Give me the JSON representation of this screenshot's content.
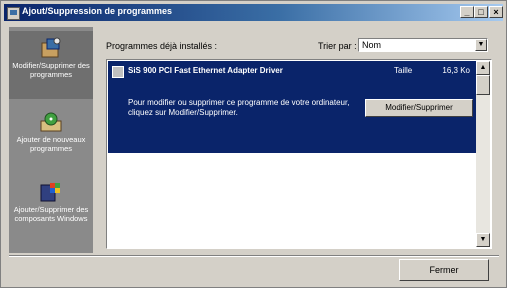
{
  "window": {
    "title": "Ajout/Suppression de programmes",
    "min": "_",
    "max": "□",
    "close": "×"
  },
  "sidebar": {
    "items": [
      {
        "label": "Modifier/Supprimer des programmes",
        "icon": "programs-box-icon"
      },
      {
        "label": "Ajouter de nouveaux programmes",
        "icon": "install-cd-icon"
      },
      {
        "label": "Ajouter/Supprimer des composants Windows",
        "icon": "windows-components-icon"
      }
    ]
  },
  "main": {
    "installed_label": "Programmes déjà installés :",
    "sort_label": "Trier par :",
    "sort_value": "Nom",
    "program": {
      "name": "SiS 900 PCI Fast Ethernet Adapter Driver",
      "size_label": "Taille",
      "size": "16,3 Ko",
      "description": "Pour modifier ou supprimer ce programme de votre ordinateur, cliquez sur Modifier/Supprimer.",
      "action_label": "Modifier/Supprimer"
    }
  },
  "footer": {
    "close_label": "Fermer"
  }
}
